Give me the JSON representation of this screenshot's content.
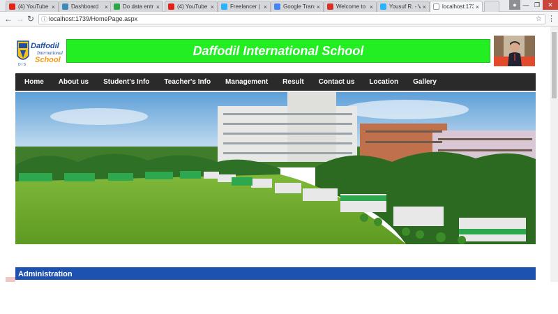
{
  "browser": {
    "tabs": [
      {
        "title": "(4) YouTube",
        "icon": "youtube-icon",
        "color": "#e62117"
      },
      {
        "title": "Dashboard",
        "icon": "dashboard-icon",
        "color": "#3e8ab8"
      },
      {
        "title": "Do data entr",
        "icon": "upwork-icon",
        "color": "#2aa845"
      },
      {
        "title": "(4) YouTube",
        "icon": "youtube-icon",
        "color": "#e62117"
      },
      {
        "title": "Freelancer |",
        "icon": "freelancer-icon",
        "color": "#29b2fe"
      },
      {
        "title": "Google Trans",
        "icon": "google-translate-icon",
        "color": "#4285f4"
      },
      {
        "title": "Welcome to",
        "icon": "gmail-icon",
        "color": "#d93025"
      },
      {
        "title": "Yousuf R. - V",
        "icon": "freelancer-icon",
        "color": "#29b2fe"
      },
      {
        "title": "localhost:173",
        "icon": "page-icon",
        "color": "#ffffff"
      }
    ],
    "address": "localhost:1739/HomePage.aspx",
    "active_tab_index": 8
  },
  "page": {
    "logo": {
      "line1": "Daffodil",
      "line2": "International",
      "line3": "School"
    },
    "banner_title": "Daffodil International School",
    "nav": [
      "Home",
      "About us",
      "Student's Info",
      "Teacher's Info",
      "Management",
      "Result",
      "Contact us",
      "Location",
      "Gallery"
    ],
    "section_title": "Administration"
  },
  "colors": {
    "banner_bg": "#22ee22",
    "nav_bg": "#2a2a2a",
    "section_bg": "#1e52b0"
  }
}
